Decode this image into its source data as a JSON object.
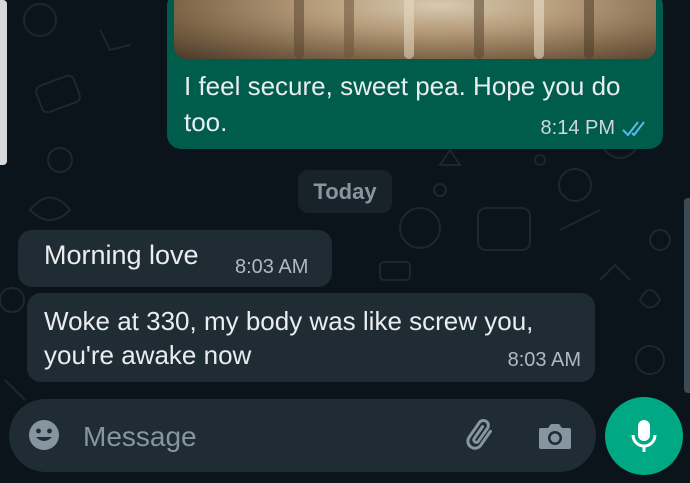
{
  "conversation": {
    "outgoing_message": {
      "text": "I feel secure, sweet pea. Hope you do too.",
      "time": "8:14 PM",
      "status": "read"
    },
    "date_divider": "Today",
    "incoming_messages": [
      {
        "text": "Morning love",
        "time": "8:03 AM"
      },
      {
        "text": "Woke at 330, my body was like screw you, you're awake now",
        "time": "8:03 AM"
      }
    ]
  },
  "composer": {
    "placeholder": "Message",
    "icons": [
      "emoji-icon",
      "paperclip-icon",
      "camera-icon",
      "microphone-icon"
    ]
  },
  "colors": {
    "background": "#0b141a",
    "outgoing_bubble": "#005c4b",
    "incoming_bubble": "#202c33",
    "accent": "#00a884",
    "read_ticks": "#53bdeb"
  }
}
